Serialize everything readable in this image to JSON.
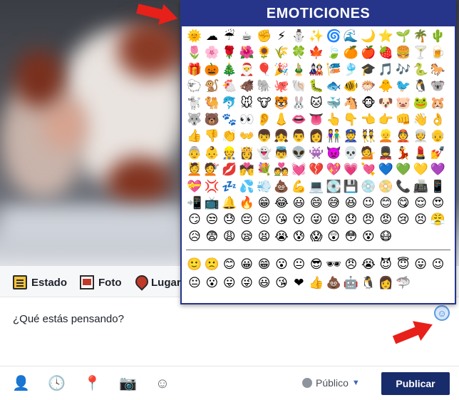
{
  "emoticons_panel": {
    "title": "EMOTICIONES",
    "emojis": [
      "🌞",
      "☁",
      "☔",
      "☕",
      "✊",
      "⚡",
      "⛄",
      "✨",
      "🌀",
      "🌊",
      "🌙",
      "⭐",
      "🌱",
      "🌴",
      "🌵",
      "🌷",
      "🌸",
      "🌹",
      "🌺",
      "🌻",
      "🌾",
      "🍀",
      "🍁",
      "🍃",
      "🍊",
      "🍎",
      "🍓",
      "🍔",
      "🍸",
      "🍺",
      "🎁",
      "🎃",
      "🎄",
      "🎅",
      "🎈",
      "🎉",
      "🎍",
      "🎎",
      "🎏",
      "🎐",
      "🎓",
      "🎵",
      "🎶",
      "🐍",
      "🐎",
      "🐑",
      "🐒",
      "🐔",
      "🐗",
      "🐘",
      "🐙",
      "🐚",
      "🐛",
      "🐟",
      "🐠",
      "🐡",
      "🐥",
      "🐦",
      "🐧",
      "🐨",
      "🐩",
      "🐫",
      "🐬",
      "🐭",
      "🐮",
      "🐯",
      "🐰",
      "🐱",
      "🐳",
      "🐴",
      "🐵",
      "🐶",
      "🐷",
      "🐸",
      "🐹",
      "🐺",
      "🐻",
      "🐾",
      "👀",
      "👂",
      "👃",
      "👄",
      "👅",
      "👆",
      "👇",
      "👈",
      "👉",
      "👊",
      "👋",
      "👌",
      "👍",
      "👎",
      "👏",
      "👐",
      "👦",
      "👧",
      "👨",
      "👩",
      "👫",
      "👮",
      "👯",
      "👱",
      "👲",
      "👳",
      "👴",
      "👵",
      "👶",
      "👷",
      "👸",
      "👻",
      "👼",
      "👽",
      "👾",
      "👿",
      "💀",
      "💁",
      "💂",
      "💃",
      "💄",
      "💅",
      "💆",
      "💇",
      "💋",
      "💏",
      "💐",
      "💑",
      "💓",
      "💔",
      "💖",
      "💗",
      "💘",
      "💙",
      "💚",
      "💛",
      "💜",
      "💝",
      "💢",
      "💤",
      "💦",
      "💨",
      "💩",
      "💪",
      "💻",
      "💽",
      "💾",
      "💿",
      "📀",
      "📞",
      "📠",
      "📱",
      "📲",
      "📺",
      "🔔",
      "🔥",
      "😁",
      "😂",
      "😃",
      "😄",
      "😅",
      "😆",
      "😉",
      "😊",
      "😋",
      "😌",
      "😍",
      "😏",
      "😒",
      "😓",
      "😔",
      "😖",
      "😘",
      "😚",
      "😜",
      "😝",
      "😞",
      "😠",
      "😡",
      "😢",
      "😣",
      "😤",
      "😥",
      "😨",
      "😩",
      "😪",
      "😫",
      "😭",
      "😰",
      "😱",
      "😲",
      "😳",
      "😵",
      "😷"
    ],
    "emojis_secondary": [
      "🙂",
      "🙁",
      "😊",
      "😀",
      "😁",
      "😮",
      "😐",
      "😎",
      "🕶",
      "😠",
      "😭",
      "😈",
      "😇",
      "😛",
      "😉",
      "😐",
      "😮",
      "😛",
      "😜",
      "😃",
      "😘",
      "❤",
      "👍",
      "💩",
      "🤖",
      "🐧",
      "👩",
      "🦈"
    ]
  },
  "composer": {
    "tabs": [
      {
        "label": "Estado",
        "icon": "note-icon"
      },
      {
        "label": "Foto",
        "icon": "photo-icon"
      },
      {
        "label": "Lugar",
        "icon": "pin-icon"
      }
    ],
    "placeholder": "¿Qué estás pensando?",
    "privacy_label": "Público",
    "publish_label": "Publicar",
    "bottom_icons": [
      "tag-friends-icon",
      "clock-icon",
      "location-icon",
      "camera-icon",
      "emoticon-icon"
    ]
  },
  "colors": {
    "panel_blue": "#26358a",
    "publish_blue": "#182b6b",
    "arrow_red": "#e8201a"
  }
}
